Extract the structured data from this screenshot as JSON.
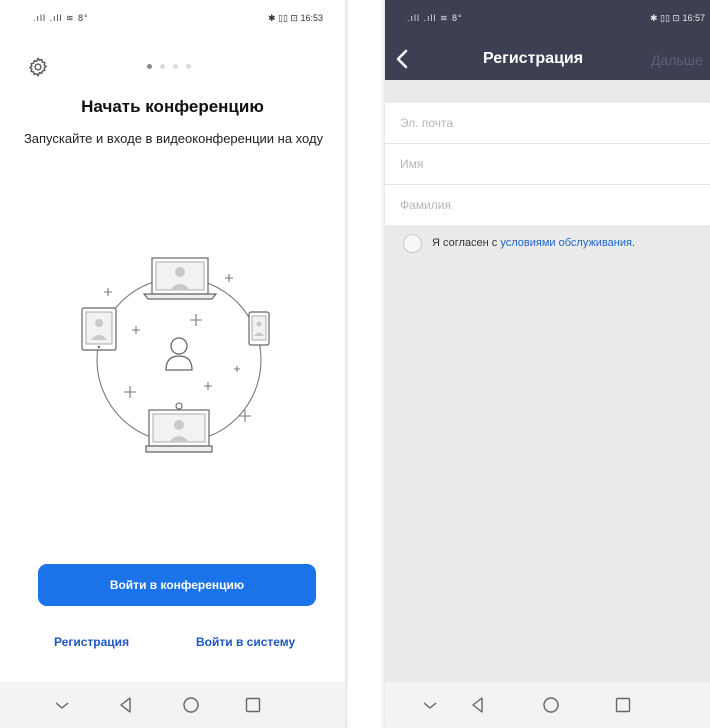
{
  "left": {
    "status": {
      "signal": ".ıll .ıll ≋ 8°",
      "right": "✱ ▯▯ ⊡ 16:53"
    },
    "title": "Начать конференцию",
    "description": "Запускайте и входе в видеоконференции на ходу",
    "join_button": "Войти в конференцию",
    "register_link": "Регистрация",
    "login_link": "Войти в систему",
    "pager": {
      "total": 4,
      "active": 0
    },
    "accent": "#1a73e8",
    "link_color": "#1f56c2"
  },
  "right": {
    "status": {
      "signal": ".ıll .ıll ≋ 8°",
      "right": "✱ ▯▯ ⊡ 16:57"
    },
    "header_title": "Регистрация",
    "next_label": "Дальше",
    "fields": [
      {
        "placeholder": "Эл. почта",
        "value": ""
      },
      {
        "placeholder": "Имя",
        "value": ""
      },
      {
        "placeholder": "Фамилия",
        "value": ""
      }
    ],
    "agree_prefix": "Я согласен с ",
    "terms_link": "условиями обслуживания",
    "agree_suffix": ".",
    "header_color": "#3d3f52"
  },
  "nav": {
    "icons": [
      "chevron-down-icon",
      "back-triangle-icon",
      "home-circle-icon",
      "recent-square-icon"
    ]
  }
}
